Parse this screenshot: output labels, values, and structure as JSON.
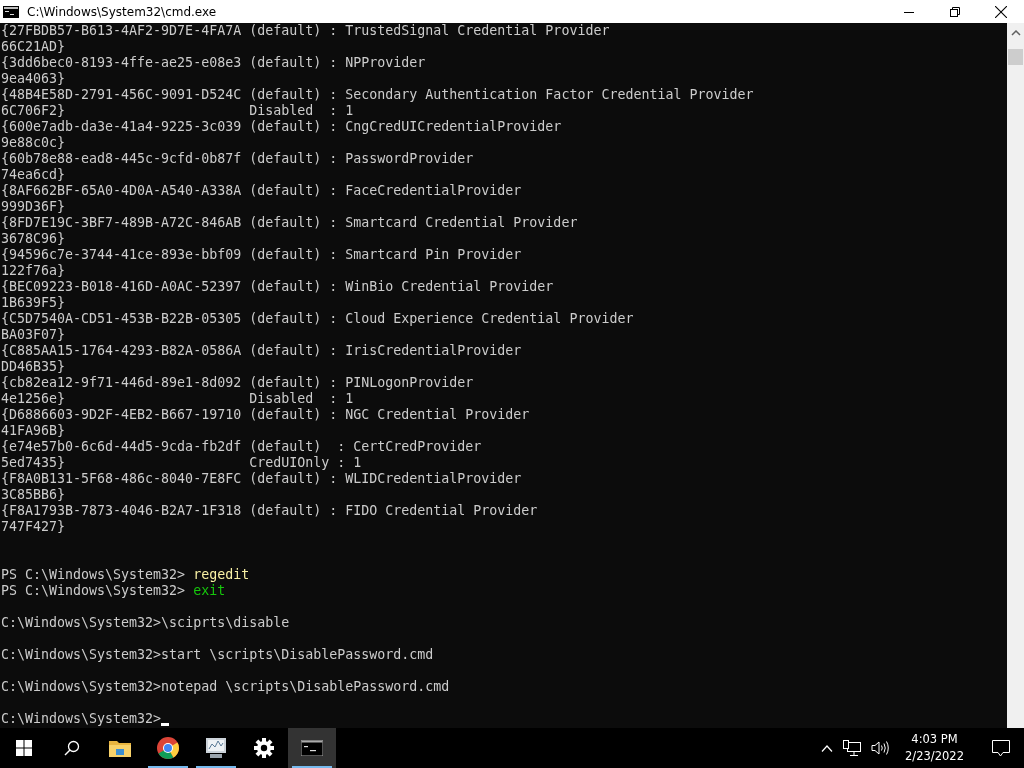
{
  "window": {
    "title": "C:\\Windows\\System32\\cmd.exe"
  },
  "console": {
    "lines": [
      {
        "kind": "text",
        "text": "{27FBDB57-B613-4AF2-9D7E-4FA7A (default) : TrustedSignal Credential Provider"
      },
      {
        "kind": "text",
        "text": "66C21AD}"
      },
      {
        "kind": "text",
        "text": "{3dd6bec0-8193-4ffe-ae25-e08e3 (default) : NPProvider"
      },
      {
        "kind": "text",
        "text": "9ea4063}"
      },
      {
        "kind": "text",
        "text": "{48B4E58D-2791-456C-9091-D524C (default) : Secondary Authentication Factor Credential Provider"
      },
      {
        "kind": "text",
        "text": "6C706F2}                       Disabled  : 1"
      },
      {
        "kind": "text",
        "text": "{600e7adb-da3e-41a4-9225-3c039 (default) : CngCredUICredentialProvider"
      },
      {
        "kind": "text",
        "text": "9e88c0c}"
      },
      {
        "kind": "text",
        "text": "{60b78e88-ead8-445c-9cfd-0b87f (default) : PasswordProvider"
      },
      {
        "kind": "text",
        "text": "74ea6cd}"
      },
      {
        "kind": "text",
        "text": "{8AF662BF-65A0-4D0A-A540-A338A (default) : FaceCredentialProvider"
      },
      {
        "kind": "text",
        "text": "999D36F}"
      },
      {
        "kind": "text",
        "text": "{8FD7E19C-3BF7-489B-A72C-846AB (default) : Smartcard Credential Provider"
      },
      {
        "kind": "text",
        "text": "3678C96}"
      },
      {
        "kind": "text",
        "text": "{94596c7e-3744-41ce-893e-bbf09 (default) : Smartcard Pin Provider"
      },
      {
        "kind": "text",
        "text": "122f76a}"
      },
      {
        "kind": "text",
        "text": "{BEC09223-B018-416D-A0AC-52397 (default) : WinBio Credential Provider"
      },
      {
        "kind": "text",
        "text": "1B639F5}"
      },
      {
        "kind": "text",
        "text": "{C5D7540A-CD51-453B-B22B-05305 (default) : Cloud Experience Credential Provider"
      },
      {
        "kind": "text",
        "text": "BA03F07}"
      },
      {
        "kind": "text",
        "text": "{C885AA15-1764-4293-B82A-0586A (default) : IrisCredentialProvider"
      },
      {
        "kind": "text",
        "text": "DD46B35}"
      },
      {
        "kind": "text",
        "text": "{cb82ea12-9f71-446d-89e1-8d092 (default) : PINLogonProvider"
      },
      {
        "kind": "text",
        "text": "4e1256e}                       Disabled  : 1"
      },
      {
        "kind": "text",
        "text": "{D6886603-9D2F-4EB2-B667-19710 (default) : NGC Credential Provider"
      },
      {
        "kind": "text",
        "text": "41FA96B}"
      },
      {
        "kind": "text",
        "text": "{e74e57b0-6c6d-44d5-9cda-fb2df (default)  : CertCredProvider"
      },
      {
        "kind": "text",
        "text": "5ed7435}                       CredUIOnly : 1"
      },
      {
        "kind": "text",
        "text": "{F8A0B131-5F68-486c-8040-7E8FC (default) : WLIDCredentialProvider"
      },
      {
        "kind": "text",
        "text": "3C85BB6}"
      },
      {
        "kind": "text",
        "text": "{F8A1793B-7873-4046-B2A7-1F318 (default) : FIDO Credential Provider"
      },
      {
        "kind": "text",
        "text": "747F427}"
      },
      {
        "kind": "blank"
      },
      {
        "kind": "blank"
      },
      {
        "kind": "command",
        "prompt": "PS C:\\Windows\\System32>",
        "command": "regedit",
        "color": "#f9f1a5"
      },
      {
        "kind": "command",
        "prompt": "PS C:\\Windows\\System32>",
        "command": "exit",
        "color": "#16c60c"
      },
      {
        "kind": "blank"
      },
      {
        "kind": "command",
        "prompt": "C:\\Windows\\System32>",
        "command": "\\sciprts\\disable",
        "color": "#cccccc"
      },
      {
        "kind": "blank"
      },
      {
        "kind": "command",
        "prompt": "C:\\Windows\\System32>",
        "command": "start \\scripts\\DisablePassword.cmd",
        "color": "#cccccc"
      },
      {
        "kind": "blank"
      },
      {
        "kind": "command",
        "prompt": "C:\\Windows\\System32>",
        "command": "notepad \\scripts\\DisablePassword.cmd",
        "color": "#cccccc"
      },
      {
        "kind": "blank"
      },
      {
        "kind": "prompt",
        "prompt": "C:\\Windows\\System32>",
        "cursor": true
      }
    ]
  },
  "taskbar": {
    "apps": [
      {
        "kind": "start",
        "running": false,
        "active": false
      },
      {
        "kind": "search",
        "running": false,
        "active": false
      },
      {
        "kind": "folder",
        "running": false,
        "active": false
      },
      {
        "kind": "browser",
        "running": true,
        "active": false
      },
      {
        "kind": "monitor",
        "running": true,
        "active": false
      },
      {
        "kind": "gear",
        "running": false,
        "active": false
      },
      {
        "kind": "terminal",
        "running": true,
        "active": true
      }
    ],
    "time": "4:03 PM",
    "date": "2/23/2022"
  }
}
